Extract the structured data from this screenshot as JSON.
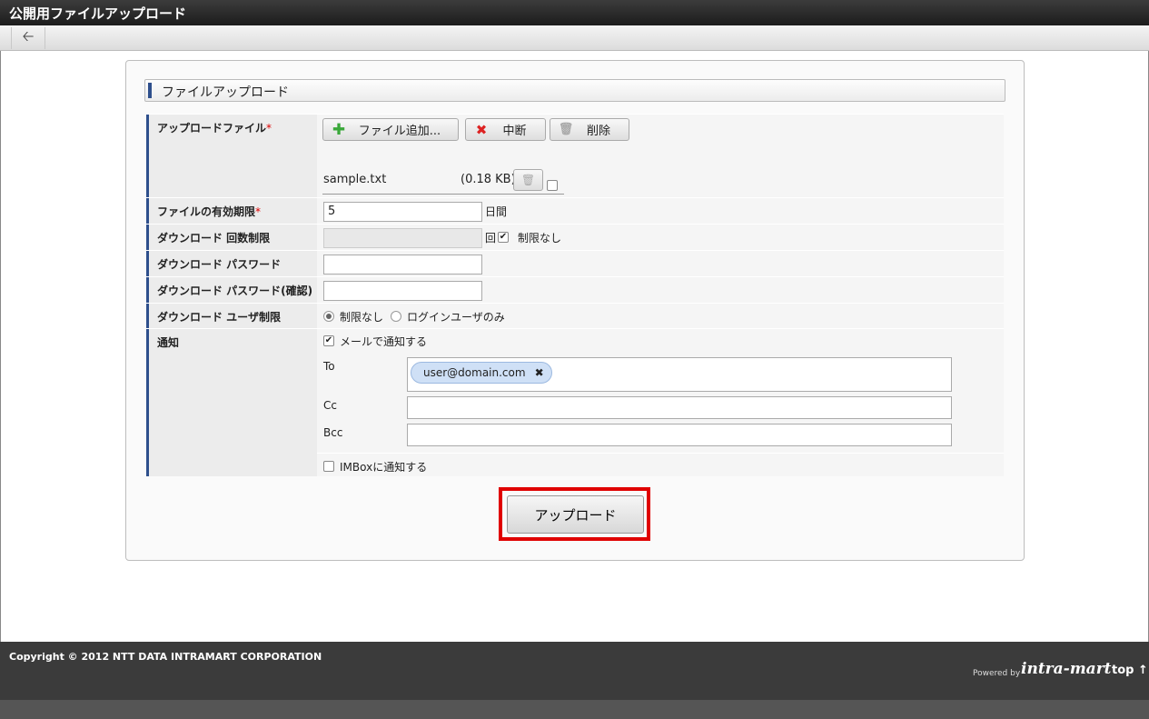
{
  "window": {
    "title": "公開用ファイルアップロード"
  },
  "toolbar": {
    "back_icon": "arrow-left-icon"
  },
  "form": {
    "section_title": "ファイルアップロード",
    "required_mark": "*",
    "upload_file": {
      "label": "アップロードファイル",
      "add_button": "ファイル追加...",
      "cancel_button": "中断",
      "delete_button": "削除",
      "file_name": "sample.txt",
      "file_size": "(0.18 KB)"
    },
    "expiry": {
      "label": "ファイルの有効期限",
      "value": "5",
      "unit": "日間"
    },
    "download_limit": {
      "label": "ダウンロード 回数制限",
      "value": "",
      "unit": "回",
      "unlimited_label": "制限なし",
      "unlimited_checked": true
    },
    "password": {
      "label": "ダウンロード パスワード",
      "value": ""
    },
    "password_confirm": {
      "label": "ダウンロード パスワード(確認)",
      "value": ""
    },
    "user_limit": {
      "label": "ダウンロード ユーザ制限",
      "options": [
        "制限なし",
        "ログインユーザのみ"
      ],
      "selected": "制限なし"
    },
    "notify": {
      "label": "通知",
      "mail_label": "メールで通知する",
      "mail_checked": true,
      "to_label": "To",
      "to_recipients": [
        "user@domain.com"
      ],
      "cc_label": "Cc",
      "bcc_label": "Bcc",
      "imbox_label": "IMBoxに通知する",
      "imbox_checked": false
    },
    "upload_button": "アップロード"
  },
  "footer": {
    "copyright": "Copyright © 2012 NTT DATA INTRAMART CORPORATION",
    "powered_by": "Powered by",
    "brand": "intra-mart",
    "top_link": "top ↑"
  },
  "colors": {
    "accent": "#2e4f8c",
    "highlight": "#e00000",
    "footer": "#3b3b3b"
  }
}
